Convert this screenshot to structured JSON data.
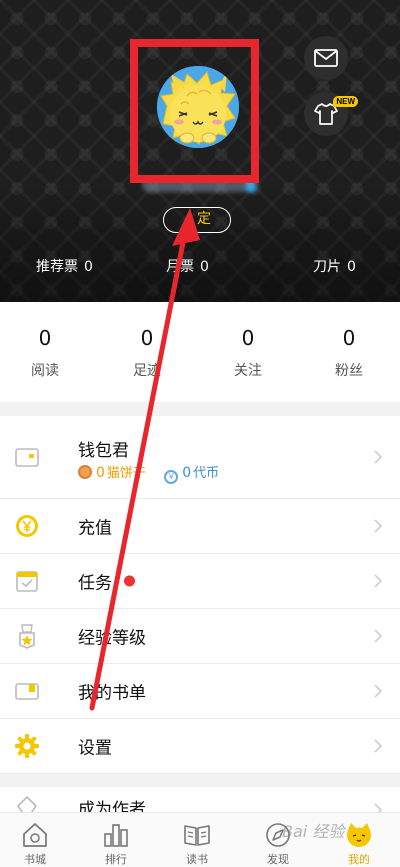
{
  "header": {
    "bind_label": "绑定",
    "stats": [
      {
        "label": "推荐票",
        "value": "0"
      },
      {
        "label": "月票",
        "value": "0"
      },
      {
        "label": "刀片",
        "value": "0"
      }
    ],
    "new_badge": "NEW",
    "bind_visible_text": "定",
    "stat_visible_label_1": "月票"
  },
  "counts": [
    {
      "value": "0",
      "label": "阅读"
    },
    {
      "value": "0",
      "label": "足迹"
    },
    {
      "value": "0",
      "label": "关注"
    },
    {
      "value": "0",
      "label": "粉丝"
    }
  ],
  "menu": {
    "wallet": {
      "title": "钱包君",
      "cat_value": "0",
      "cat_label": "猫饼干",
      "token_value": "0",
      "token_label": "代币",
      "token_symbol": "￥"
    },
    "items": [
      {
        "label": "充值",
        "icon": "yen-coin-icon"
      },
      {
        "label": "任务",
        "icon": "calendar-check-icon"
      },
      {
        "label": "经验等级",
        "icon": "medal-icon"
      },
      {
        "label": "我的书单",
        "icon": "book-list-icon"
      },
      {
        "label": "设置",
        "icon": "gear-icon"
      }
    ],
    "next_item_label": "成为作者"
  },
  "tabbar": [
    {
      "label": "书城",
      "icon": "home-icon"
    },
    {
      "label": "排行",
      "icon": "ranking-icon"
    },
    {
      "label": "读书",
      "icon": "book-open-icon"
    },
    {
      "label": "发现",
      "icon": "compass-icon"
    },
    {
      "label": "我的",
      "icon": "cat-avatar-icon"
    }
  ],
  "colors": {
    "accent": "#f6c700",
    "annotation": "#e8262d",
    "header_bg": "#1e1e1e",
    "red_dot": "#ee3333",
    "token_blue": "#3b8fd6",
    "cookie_orange": "#f0a000"
  },
  "watermark": "Bai 经验"
}
